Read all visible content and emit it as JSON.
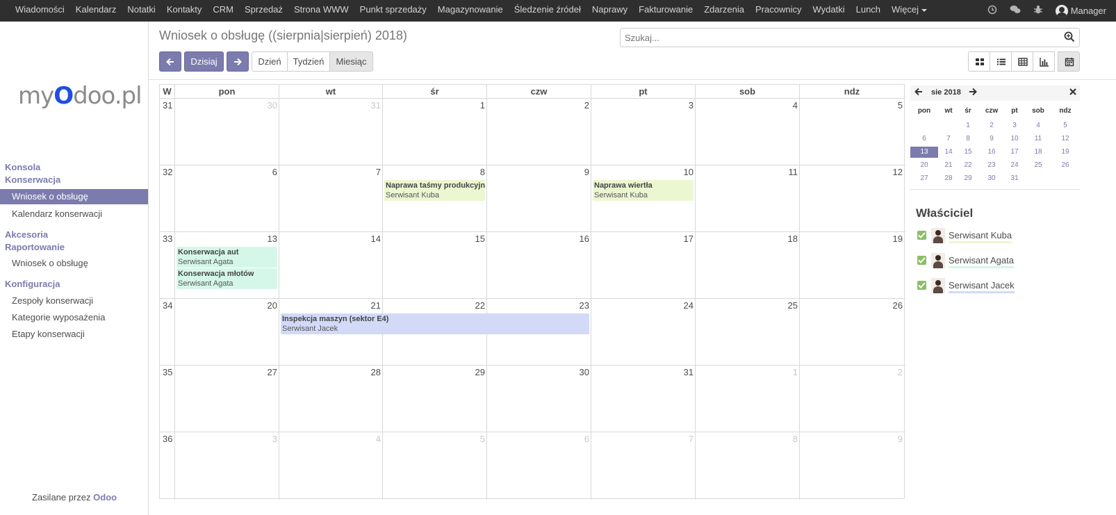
{
  "topbar": {
    "menu": [
      "Wiadomości",
      "Kalendarz",
      "Notatki",
      "Kontakty",
      "CRM",
      "Sprzedaż",
      "Strona WWW",
      "Punkt sprzedaży",
      "Magazynowanie",
      "Śledzenie źródeł",
      "Naprawy",
      "Fakturowanie",
      "Zdarzenia",
      "Pracownicy",
      "Wydatki",
      "Lunch",
      "Więcej"
    ],
    "user": "Manager"
  },
  "sidebar": {
    "logo_pre": "my",
    "logo_o": "O",
    "logo_post": "doo.pl",
    "sections": [
      {
        "title": "Konsola"
      },
      {
        "title": "Konserwacja",
        "items": [
          "Wniosek o obsługę",
          "Kalendarz konserwacji"
        ]
      },
      {
        "title": "Akcesoria"
      },
      {
        "title": "Raportowanie",
        "items": [
          "Wniosek o obsługę"
        ]
      },
      {
        "title": "Konfiguracja",
        "items": [
          "Zespoły konserwacji",
          "Kategorie wyposażenia",
          "Etapy konserwacji"
        ]
      }
    ],
    "powered_pre": "Zasilane przez",
    "powered_brand": "Odoo"
  },
  "control": {
    "title": "Wniosek o obsługę ((sierpnia|sierpień) 2018)",
    "search_placeholder": "Szukaj...",
    "today": "Dzisiaj",
    "scale_day": "Dzień",
    "scale_week": "Tydzień",
    "scale_month": "Miesiąc"
  },
  "calendar": {
    "headers": [
      "W",
      "pon",
      "wt",
      "śr",
      "czw",
      "pt",
      "sob",
      "ndz"
    ],
    "weeks": [
      {
        "num": "31",
        "days": [
          [
            "30",
            1
          ],
          [
            "31",
            1
          ],
          [
            "1",
            0
          ],
          [
            "2",
            0
          ],
          [
            "3",
            0
          ],
          [
            "4",
            0
          ],
          [
            "5",
            0
          ]
        ]
      },
      {
        "num": "32",
        "days": [
          [
            "6",
            0
          ],
          [
            "7",
            0
          ],
          [
            "8",
            0
          ],
          [
            "9",
            0
          ],
          [
            "10",
            0
          ],
          [
            "11",
            0
          ],
          [
            "12",
            0
          ]
        ]
      },
      {
        "num": "33",
        "days": [
          [
            "13",
            0
          ],
          [
            "14",
            0
          ],
          [
            "15",
            0
          ],
          [
            "16",
            0
          ],
          [
            "17",
            0
          ],
          [
            "18",
            0
          ],
          [
            "19",
            0
          ]
        ]
      },
      {
        "num": "34",
        "days": [
          [
            "20",
            0
          ],
          [
            "21",
            0
          ],
          [
            "22",
            0
          ],
          [
            "23",
            0
          ],
          [
            "24",
            0
          ],
          [
            "25",
            0
          ],
          [
            "26",
            0
          ]
        ]
      },
      {
        "num": "35",
        "days": [
          [
            "27",
            0
          ],
          [
            "28",
            0
          ],
          [
            "29",
            0
          ],
          [
            "30",
            0
          ],
          [
            "31",
            0
          ],
          [
            "1",
            1
          ],
          [
            "2",
            1
          ]
        ]
      },
      {
        "num": "36",
        "days": [
          [
            "3",
            1
          ],
          [
            "4",
            1
          ],
          [
            "5",
            1
          ],
          [
            "6",
            1
          ],
          [
            "7",
            1
          ],
          [
            "8",
            1
          ],
          [
            "9",
            1
          ]
        ]
      }
    ],
    "events": [
      {
        "title": "Naprawa taśmy produkcyjnej",
        "owner": "Serwisant Kuba",
        "week": 1,
        "day": 2,
        "span": 1,
        "slot": 0,
        "color": "#ecf7d2"
      },
      {
        "title": "Naprawa wiertła",
        "owner": "Serwisant Kuba",
        "week": 1,
        "day": 4,
        "span": 1,
        "slot": 0,
        "color": "#ecf7d2"
      },
      {
        "title": "Konserwacja aut",
        "owner": "Serwisant Agata",
        "week": 2,
        "day": 0,
        "span": 1,
        "slot": 0,
        "color": "#d5f7e9"
      },
      {
        "title": "Konserwacja młotów",
        "owner": "Serwisant Agata",
        "week": 2,
        "day": 0,
        "span": 1,
        "slot": 1,
        "color": "#d5f7e9"
      },
      {
        "title": "Inspekcja maszyn (sektor E4)",
        "owner": "Serwisant Jacek",
        "week": 3,
        "day": 1,
        "span": 3,
        "slot": 0,
        "color": "#d2daf7"
      }
    ]
  },
  "mini_calendar": {
    "title": "sie 2018",
    "dow": [
      "pon",
      "wt",
      "śr",
      "czw",
      "pt",
      "sob",
      "ndz"
    ],
    "rows": [
      [
        "",
        "",
        "1",
        "2",
        "3",
        "4",
        "5"
      ],
      [
        "6",
        "7",
        "8",
        "9",
        "10",
        "11",
        "12"
      ],
      [
        "13",
        "14",
        "15",
        "16",
        "17",
        "18",
        "19"
      ],
      [
        "20",
        "21",
        "22",
        "23",
        "24",
        "25",
        "26"
      ],
      [
        "27",
        "28",
        "29",
        "30",
        "31",
        "",
        ""
      ]
    ],
    "today": "13"
  },
  "owners": {
    "title": "Właściciel",
    "list": [
      {
        "name": "Serwisant Kuba",
        "color": "#ecf7d2"
      },
      {
        "name": "Serwisant Agata",
        "color": "#d5f7e9"
      },
      {
        "name": "Serwisant Jacek",
        "color": "#d2daf7"
      }
    ]
  },
  "colors": {
    "accent": "#7c7bad",
    "topbar": "#2f2f2f"
  }
}
